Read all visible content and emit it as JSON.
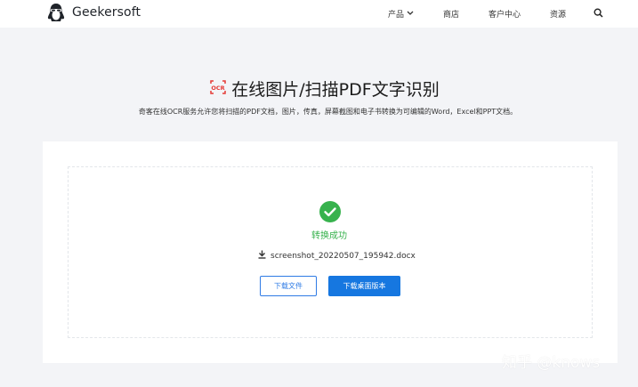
{
  "header": {
    "brand": "Geekersoft",
    "nav": {
      "products": "产品",
      "store": "商店",
      "support": "客户中心",
      "resources": "资源"
    }
  },
  "main": {
    "title": "在线图片/扫描PDF文字识别",
    "title_icon_label": "OCR",
    "subtitle": "奇客在线OCR服务允许您将扫描的PDF文档，图片，传真，屏幕截图和电子书转换为可编辑的Word，Excel和PPT文档。"
  },
  "result": {
    "status": "转换成功",
    "filename": "screenshot_20220507_195942.docx",
    "download_button": "下载文件",
    "desktop_button": "下载桌面版本"
  },
  "watermark": "知乎 @knows",
  "colors": {
    "accent": "#1677e0",
    "success": "#37b24d",
    "ocr_icon": "#e53935"
  }
}
